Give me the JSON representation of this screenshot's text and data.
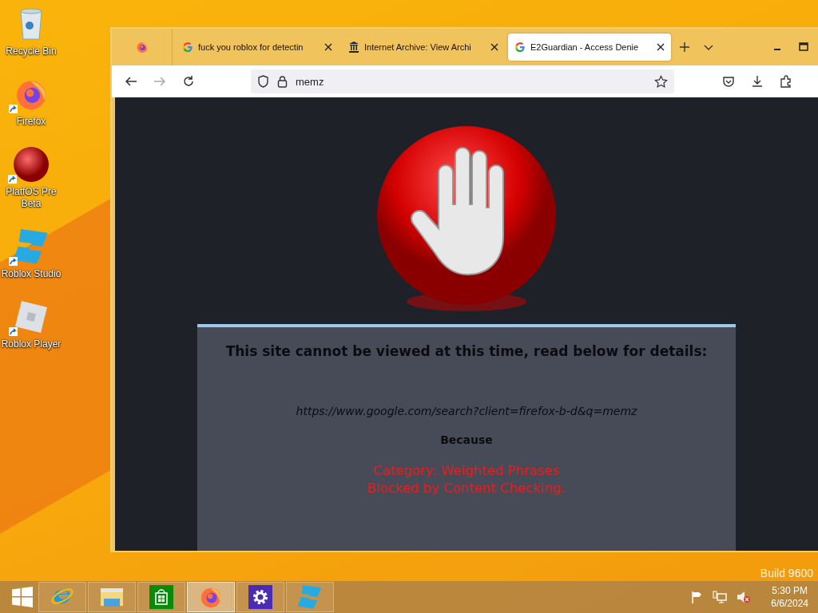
{
  "desktop": {
    "icons": [
      {
        "kind": "recycle",
        "label": "Recycle Bin",
        "shortcut": false
      },
      {
        "kind": "firefox",
        "label": "Firefox",
        "shortcut": true
      },
      {
        "kind": "sphere",
        "label": "PlatfOS Pre Beta",
        "shortcut": true
      },
      {
        "kind": "studio",
        "label": "Roblox Studio",
        "shortcut": true
      },
      {
        "kind": "player",
        "label": "Roblox Player",
        "shortcut": true
      }
    ],
    "build_text": "Build 9600"
  },
  "browser": {
    "tabs": [
      {
        "kind": "view",
        "selected": false
      },
      {
        "kind": "google",
        "label": "fuck you roblox for detectin",
        "selected": false
      },
      {
        "kind": "archive",
        "label": "Internet Archive: View Archi",
        "selected": false
      },
      {
        "kind": "google",
        "label": "E2Guardian - Access Denie",
        "selected": true
      }
    ],
    "address": "memz",
    "page": {
      "heading": "This site cannot be viewed at this time, read below for details:",
      "url": "https://www.google.com/search?client=firefox-b-d&q=memz",
      "because": "Because",
      "reasons": [
        "Category: Weighted Phrases",
        "Blocked by Content Checking."
      ]
    }
  },
  "taskbar": {
    "apps": [
      {
        "kind": "ie",
        "active": false
      },
      {
        "kind": "explorer",
        "active": false
      },
      {
        "kind": "store",
        "active": false
      },
      {
        "kind": "firefox",
        "active": true
      },
      {
        "kind": "settings",
        "active": false
      },
      {
        "kind": "studio",
        "active": false
      }
    ],
    "time": "5:30 PM",
    "date": "6/6/2024"
  }
}
